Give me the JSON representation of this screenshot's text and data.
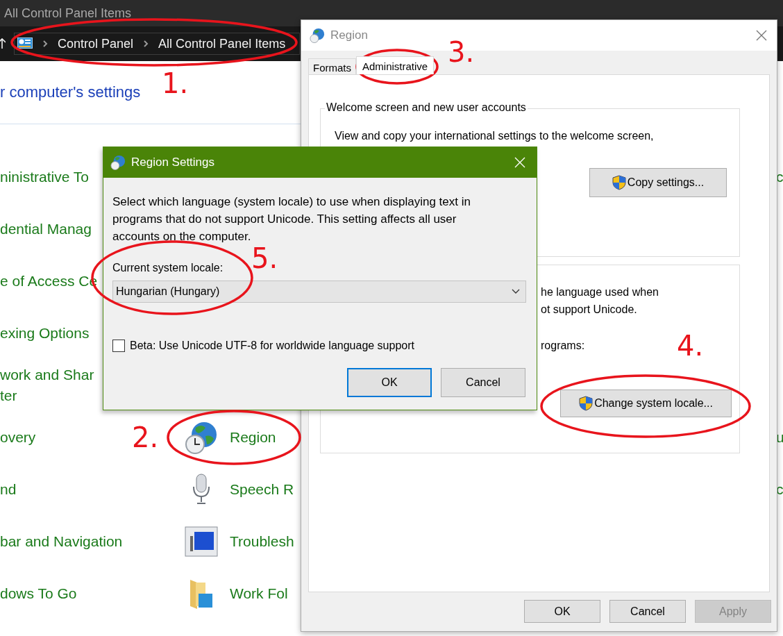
{
  "explorer": {
    "title": "All Control Panel Items",
    "breadcrumb": [
      "Control Panel",
      "All Control Panel Items"
    ],
    "heading": "r computer's settings",
    "rows": [
      {
        "left": [
          "ninistrative To"
        ],
        "right": [
          "c"
        ]
      },
      {
        "left": [
          "dential Manag"
        ]
      },
      {
        "left": [
          "e of Access Ce"
        ]
      },
      {
        "left": [
          "exing Options"
        ]
      },
      {
        "left": [
          "work and Shar",
          "ter"
        ]
      },
      {
        "left": [
          "overy"
        ],
        "middle": "Region",
        "right": [
          "u"
        ]
      },
      {
        "left": [
          "nd"
        ],
        "middle": "Speech R",
        "right": [
          "c"
        ]
      },
      {
        "left": [
          "bar and Navigation"
        ],
        "middle": "Troublesh"
      },
      {
        "left": [
          "dows To Go"
        ],
        "middle": "Work Fol"
      }
    ]
  },
  "region_window": {
    "title": "Region",
    "active": false,
    "tabs": [
      {
        "label": "Formats",
        "selected": false
      },
      {
        "label": "Administrative",
        "selected": true
      }
    ],
    "welcome_group": {
      "title": "Welcome screen and new user accounts",
      "text": "View and copy your international settings to the welcome screen,",
      "button": "Copy settings..."
    },
    "unicode_group": {
      "lines": [
        "he language used when",
        "ot support Unicode."
      ],
      "label": "rograms:",
      "button": "Change system locale..."
    },
    "buttons": [
      {
        "label": "OK",
        "disabled": false
      },
      {
        "label": "Cancel",
        "disabled": false
      },
      {
        "label": "Apply",
        "disabled": true
      }
    ]
  },
  "region_settings_dialog": {
    "title": "Region Settings",
    "active": true,
    "text": "Select which language (system locale) to use when displaying text in programs that do not support Unicode. This setting affects all user accounts on the computer.",
    "locale_label": "Current system locale:",
    "locale_value": "Hungarian (Hungary)",
    "beta_checkbox": {
      "label": "Beta: Use Unicode UTF-8 for worldwide language support",
      "checked": false
    },
    "buttons": [
      {
        "label": "OK",
        "default": true
      },
      {
        "label": "Cancel",
        "default": false
      }
    ]
  },
  "annotations": [
    {
      "label": "1."
    },
    {
      "label": "2."
    },
    {
      "label": "3."
    },
    {
      "label": "4."
    },
    {
      "label": "5."
    }
  ]
}
